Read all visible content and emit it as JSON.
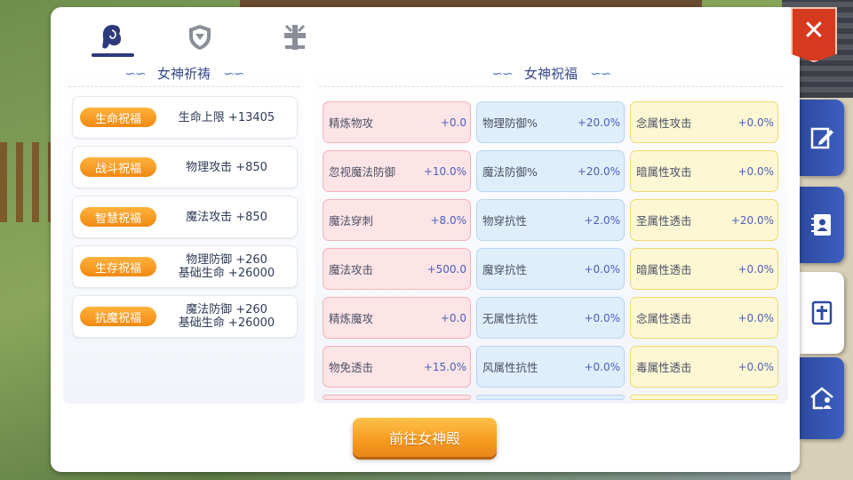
{
  "tabs": [
    {
      "icon": "goddess-head-icon",
      "active": true
    },
    {
      "icon": "shield-emblem-icon",
      "active": false
    },
    {
      "icon": "cross-emblem-icon",
      "active": false
    }
  ],
  "close_label": "✕",
  "left": {
    "title": "女神祈祷",
    "blessings": [
      {
        "tag": "生命祝福",
        "line1": "生命上限 +13405",
        "line2": ""
      },
      {
        "tag": "战斗祝福",
        "line1": "物理攻击 +850",
        "line2": ""
      },
      {
        "tag": "智慧祝福",
        "line1": "魔法攻击 +850",
        "line2": ""
      },
      {
        "tag": "生存祝福",
        "line1": "物理防御 +260",
        "line2": "基础生命 +26000"
      },
      {
        "tag": "抗魔祝福",
        "line1": "魔法防御 +260",
        "line2": "基础生命 +26000"
      }
    ]
  },
  "right": {
    "title": "女神祝福",
    "stats": [
      [
        {
          "name": "精炼物攻",
          "value": "+0.0",
          "color": "red"
        },
        {
          "name": "物理防御%",
          "value": "+20.0%",
          "color": "blue"
        },
        {
          "name": "念属性攻击",
          "value": "+0.0%",
          "color": "yellow"
        }
      ],
      [
        {
          "name": "忽视魔法防御",
          "value": "+10.0%",
          "color": "red"
        },
        {
          "name": "魔法防御%",
          "value": "+20.0%",
          "color": "blue"
        },
        {
          "name": "暗属性攻击",
          "value": "+0.0%",
          "color": "yellow"
        }
      ],
      [
        {
          "name": "魔法穿刺",
          "value": "+8.0%",
          "color": "red"
        },
        {
          "name": "物穿抗性",
          "value": "+2.0%",
          "color": "blue"
        },
        {
          "name": "圣属性透击",
          "value": "+20.0%",
          "color": "yellow"
        }
      ],
      [
        {
          "name": "魔法攻击",
          "value": "+500.0",
          "color": "red"
        },
        {
          "name": "魔穿抗性",
          "value": "+0.0%",
          "color": "blue"
        },
        {
          "name": "暗属性透击",
          "value": "+0.0%",
          "color": "yellow"
        }
      ],
      [
        {
          "name": "精炼魔攻",
          "value": "+0.0",
          "color": "red"
        },
        {
          "name": "无属性抗性",
          "value": "+0.0%",
          "color": "blue"
        },
        {
          "name": "念属性透击",
          "value": "+0.0%",
          "color": "yellow"
        }
      ],
      [
        {
          "name": "物免透击",
          "value": "+15.0%",
          "color": "red"
        },
        {
          "name": "风属性抗性",
          "value": "+0.0%",
          "color": "blue"
        },
        {
          "name": "毒属性透击",
          "value": "+0.0%",
          "color": "yellow"
        }
      ]
    ]
  },
  "go_button": "前往女神殿",
  "side_tabs": [
    {
      "icon": "edit-note-icon",
      "active": false
    },
    {
      "icon": "contact-book-icon",
      "active": false
    },
    {
      "icon": "bible-cross-icon",
      "active": true
    },
    {
      "icon": "house-person-icon",
      "active": false
    }
  ],
  "colors": {
    "accent": "#2d3a7c",
    "button_orange": "#f59a1e",
    "close_red": "#d63a1e",
    "tag_orange": "#f08a12"
  }
}
